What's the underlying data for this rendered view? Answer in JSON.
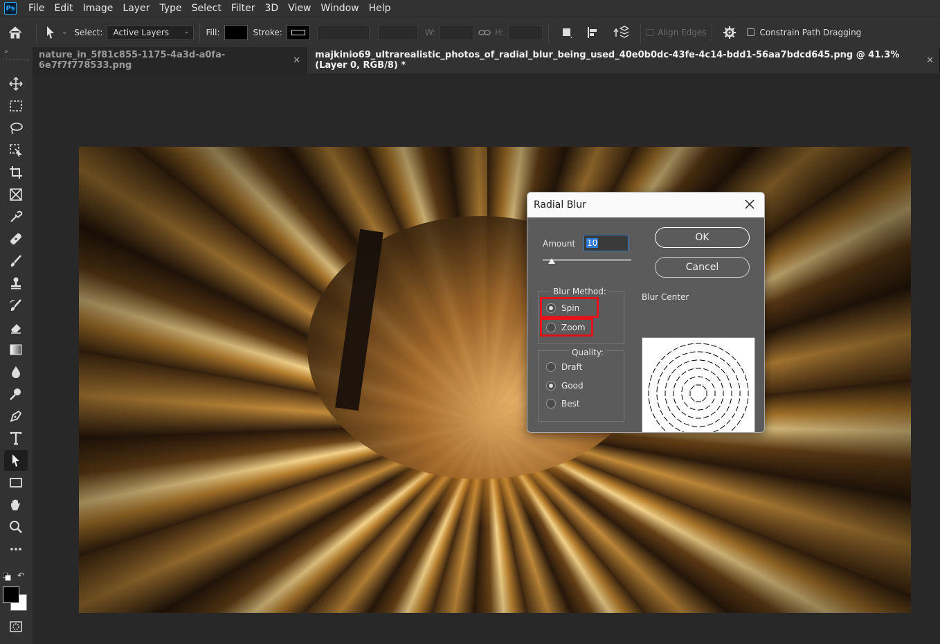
{
  "app": {
    "logo_text": "Ps",
    "menu": [
      "File",
      "Edit",
      "Image",
      "Layer",
      "Type",
      "Select",
      "Filter",
      "3D",
      "View",
      "Window",
      "Help"
    ]
  },
  "options_bar": {
    "select_label": "Select:",
    "select_value": "Active Layers",
    "fill_label": "Fill:",
    "stroke_label": "Stroke:",
    "w_label": "W:",
    "h_label": "H:",
    "align_edges_label": "Align Edges",
    "constrain_label": "Constrain Path Dragging"
  },
  "tabs": [
    {
      "label": "nature_in_5f81c855-1175-4a3d-a0fa-6e7f7f778533.png",
      "active": false
    },
    {
      "label": "majkinio69_ultrarealistic_photos_of_radial_blur_being_used_40e0b0dc-43fe-4c14-bdd1-56aa7bdcd645.png @ 41.3% (Layer 0, RGB/8) *",
      "active": true
    }
  ],
  "dialog": {
    "title": "Radial Blur",
    "amount_label": "Amount",
    "amount_value": "10",
    "amount_fraction": 0.1,
    "ok_label": "OK",
    "cancel_label": "Cancel",
    "blur_method_label": "Blur Method:",
    "blur_methods": [
      {
        "label": "Spin",
        "selected": true
      },
      {
        "label": "Zoom",
        "selected": false
      }
    ],
    "quality_label": "Quality:",
    "quality_options": [
      {
        "label": "Draft",
        "selected": false
      },
      {
        "label": "Good",
        "selected": true
      },
      {
        "label": "Best",
        "selected": false
      }
    ],
    "blur_center_label": "Blur Center"
  },
  "colors": {
    "highlight": "#e0141a",
    "focus_blue": "#2e7bd6"
  }
}
